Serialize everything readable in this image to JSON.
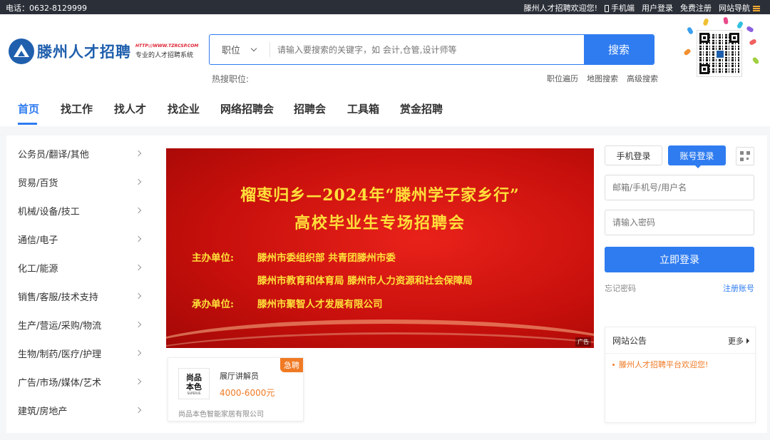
{
  "topbar": {
    "phone": "电话：0632-8129999",
    "welcome": "滕州人才招聘欢迎您!",
    "mobile": "手机端",
    "user_login": "用户登录",
    "register": "免费注册",
    "site_nav": "网站导航"
  },
  "logo": {
    "name": "滕州人才招聘",
    "url": "HTTP://WWW.TZRCSP.COM",
    "slogan": "专业的人才招聘系统"
  },
  "search": {
    "category": "职位",
    "placeholder": "请输入要搜索的关键字，如 会计,仓管,设计师等",
    "button": "搜索",
    "hot_label": "热搜职位:"
  },
  "sublinks": [
    "职位遍历",
    "地图搜索",
    "高级搜索"
  ],
  "nav": [
    "首页",
    "找工作",
    "找人才",
    "找企业",
    "网络招聘会",
    "招聘会",
    "工具箱",
    "赏金招聘"
  ],
  "categories": [
    "公务员/翻译/其他",
    "贸易/百货",
    "机械/设备/技工",
    "通信/电子",
    "化工/能源",
    "销售/客服/技术支持",
    "生产/营运/采购/物流",
    "生物/制药/医疗/护理",
    "广告/市场/媒体/艺术",
    "建筑/房地产"
  ],
  "banner": {
    "title1": "榴枣归乡—2024年“滕州学子家乡行”",
    "title2": "高校毕业生专场招聘会",
    "host_label": "主办单位:",
    "host1": "滕州市委组织部    共青团滕州市委",
    "host2": "滕州市教育和体育局    滕州市人力资源和社会保障局",
    "organizer_label": "承办单位:",
    "organizer": "滕州市聚智人才发展有限公司",
    "ad": "广告"
  },
  "job": {
    "badge": "急聘",
    "logo_line1": "尚品",
    "logo_line2": "本色",
    "logo_sub": "SUPERUS",
    "title": "展厅讲解员",
    "salary": "4000-6000元",
    "company": "尚品本色智能家居有限公司"
  },
  "login": {
    "tab_phone": "手机登录",
    "tab_account": "账号登录",
    "username_placeholder": "邮箱/手机号/用户名",
    "password_placeholder": "请输入密码",
    "button": "立即登录",
    "forgot": "忘记密码",
    "register": "注册账号"
  },
  "notice": {
    "title": "网站公告",
    "more": "更多",
    "items": [
      "滕州人才招聘平台欢迎您!"
    ]
  },
  "colors": {
    "accent": "#2f7cf0",
    "brand": "#1f5fad",
    "urgent": "#f07a24",
    "banner": "#d0150f",
    "banner_text": "#ffe03a"
  }
}
